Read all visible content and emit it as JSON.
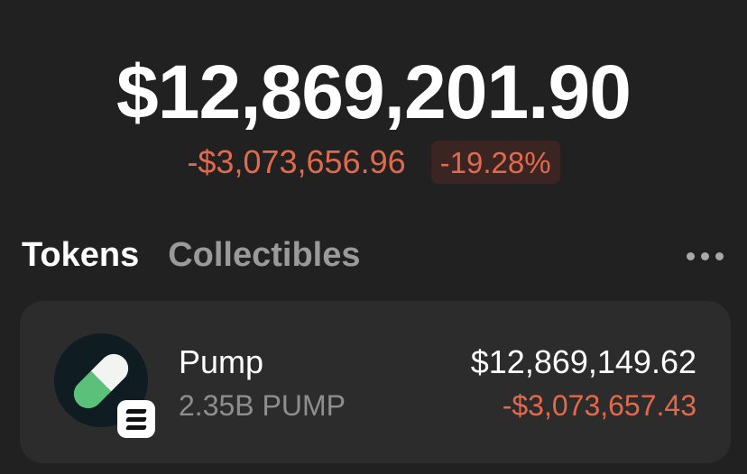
{
  "balance": {
    "total": "$12,869,201.90",
    "change_amount": "-$3,073,656.96",
    "change_percent": "-19.28%"
  },
  "tabs": [
    {
      "label": "Tokens",
      "active": true
    },
    {
      "label": "Collectibles",
      "active": false
    }
  ],
  "more_icon": "more-horizontal-icon",
  "tokens": [
    {
      "name": "Pump",
      "amount": "2.35B PUMP",
      "value": "$12,869,149.62",
      "change": "-$3,073,657.43",
      "icon": "pill-icon",
      "chain_icon": "solana-icon"
    }
  ],
  "colors": {
    "background": "#212121",
    "card": "#2c2c2c",
    "negative": "#e26a4c",
    "negative_bg": "#3a2522",
    "muted": "#9a9a9a"
  }
}
